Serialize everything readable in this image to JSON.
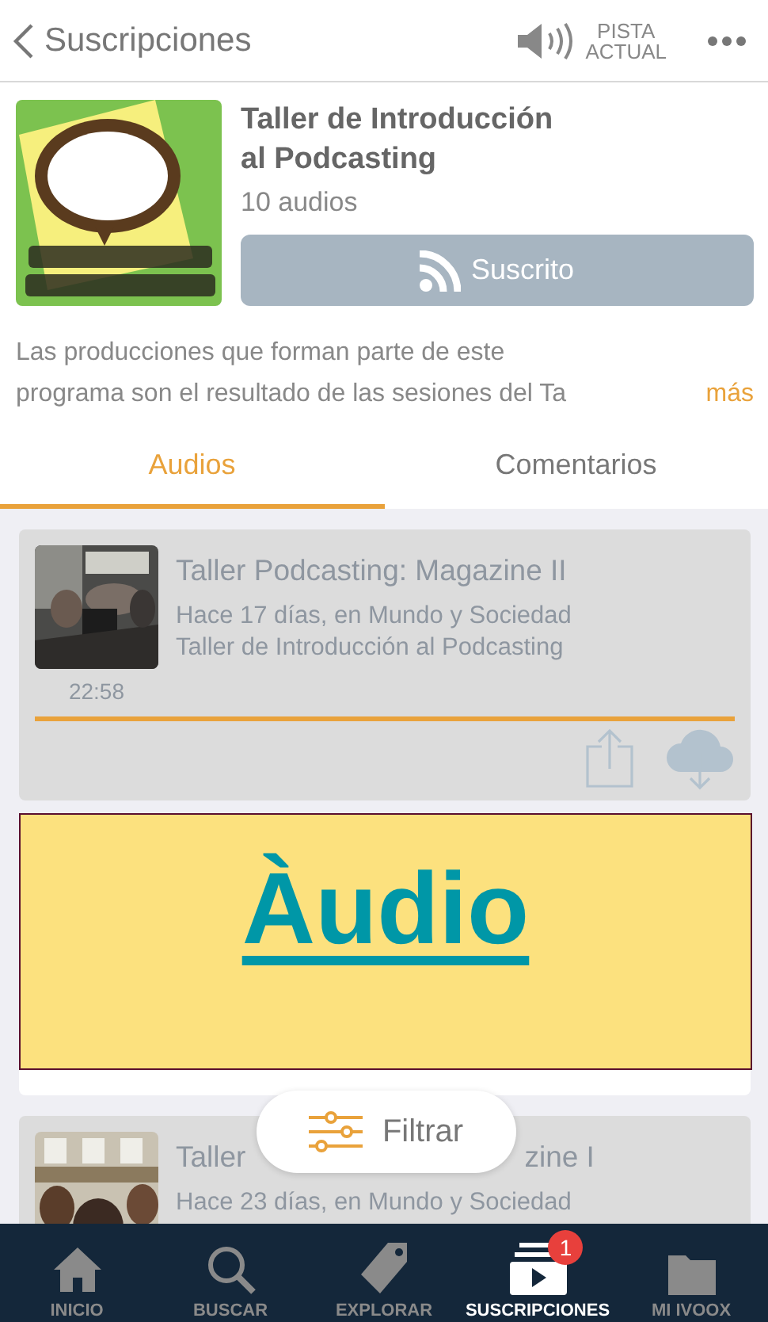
{
  "header": {
    "back_label": "Suscripciones",
    "now_playing": "PISTA\nACTUAL"
  },
  "program": {
    "title": "Taller de Introducción\nal Podcasting",
    "count": "10 audios",
    "subscribe": {
      "label": "Suscrito",
      "subscribed": true
    },
    "description_lines": [
      "Las producciones que forman parte de este",
      "programa son el resultado de las sesiones del Ta"
    ],
    "more": "más"
  },
  "tabs": [
    {
      "label": "Audios",
      "selected": true
    },
    {
      "label": "Comentarios",
      "selected": false
    }
  ],
  "episodes": [
    {
      "title_parts": [
        "Taller Podcasting: Magazine II"
      ],
      "meta": "Hace 17 días, en Mundo y Sociedad",
      "program": "Taller de Introducción al Podcasting",
      "duration": "22:58",
      "level": 1
    },
    {
      "title_parts": [
        "Taller",
        "zine I"
      ],
      "meta": "Hace 23 días, en Mundo y Sociedad"
    }
  ],
  "overlay": {
    "link": "Àudio"
  },
  "filter_button": {
    "label": "Filtrar"
  },
  "tab_bar": [
    {
      "label": "INICIO",
      "kind": "home",
      "selected": false
    },
    {
      "label": "BUSCAR",
      "kind": "search",
      "selected": false
    },
    {
      "label": "EXPLORAR",
      "kind": "explore",
      "selected": false
    },
    {
      "label": "SUSCRIPCIONES",
      "kind": "subscriptions",
      "selected": true,
      "badge": "1"
    },
    {
      "label": "MI IVOOX",
      "kind": "library",
      "selected": false
    }
  ]
}
